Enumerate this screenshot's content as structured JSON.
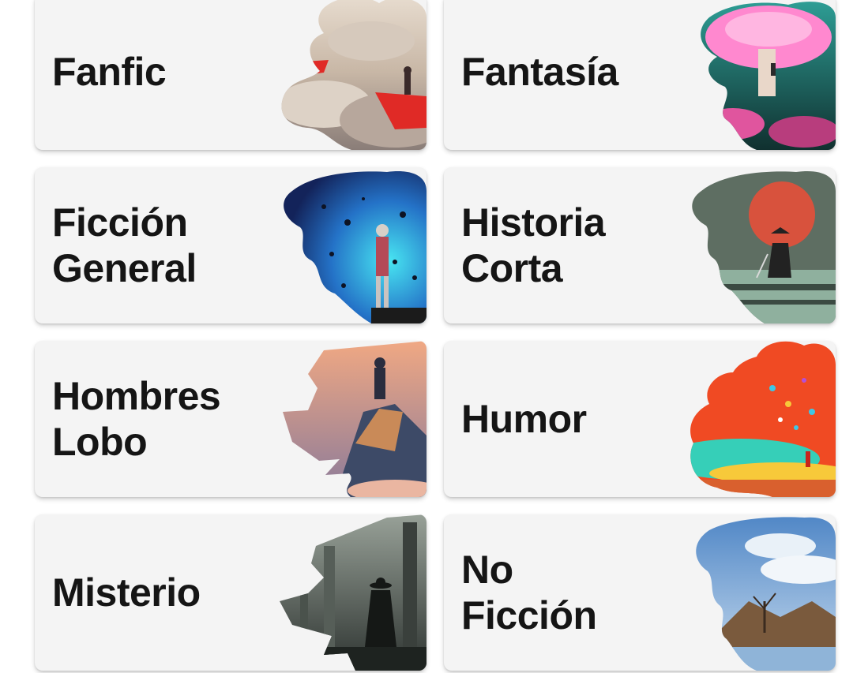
{
  "categories": [
    {
      "id": "fanfic",
      "lines": [
        "Fanfic"
      ],
      "art_icon": "paper-boat-sky-icon",
      "colors": {
        "bg1": "#d9cbbd",
        "bg2": "#9e8e86",
        "accent": "#e02a26"
      }
    },
    {
      "id": "fantasia",
      "lines": [
        "Fantasía"
      ],
      "art_icon": "giant-mushroom-icon",
      "colors": {
        "bg1": "#2e8f86",
        "bg2": "#173f3e",
        "accent": "#ff7fc4"
      }
    },
    {
      "id": "ficcion-general",
      "lines": [
        "Ficción",
        "General"
      ],
      "art_icon": "space-wanderer-icon",
      "colors": {
        "bg1": "#1a3f8c",
        "bg2": "#2ec6e6",
        "accent": "#0d1324"
      }
    },
    {
      "id": "historia-corta",
      "lines": [
        "Historia",
        "Corta"
      ],
      "art_icon": "samurai-red-moon-icon",
      "colors": {
        "bg1": "#5f6f63",
        "bg2": "#2d3a33",
        "accent": "#d8523d"
      }
    },
    {
      "id": "hombres-lobo",
      "lines": [
        "Hombres",
        "Lobo"
      ],
      "art_icon": "cliff-figure-icon",
      "colors": {
        "bg1": "#e59a73",
        "bg2": "#3d4a67",
        "accent": "#2a2d3e"
      }
    },
    {
      "id": "humor",
      "lines": [
        "Humor"
      ],
      "art_icon": "balloons-figure-icon",
      "colors": {
        "bg1": "#f04a23",
        "bg2": "#36cfb8",
        "accent": "#f7c93a"
      }
    },
    {
      "id": "misterio",
      "lines": [
        "Misterio"
      ],
      "art_icon": "rain-detective-icon",
      "colors": {
        "bg1": "#7d857e",
        "bg2": "#2e3431",
        "accent": "#151816"
      }
    },
    {
      "id": "no-ficcion",
      "lines": [
        "No",
        "Ficción"
      ],
      "art_icon": "cloudy-lake-tree-icon",
      "colors": {
        "bg1": "#5e93c9",
        "bg2": "#d9e6f2",
        "accent": "#7a5a3d"
      }
    }
  ]
}
